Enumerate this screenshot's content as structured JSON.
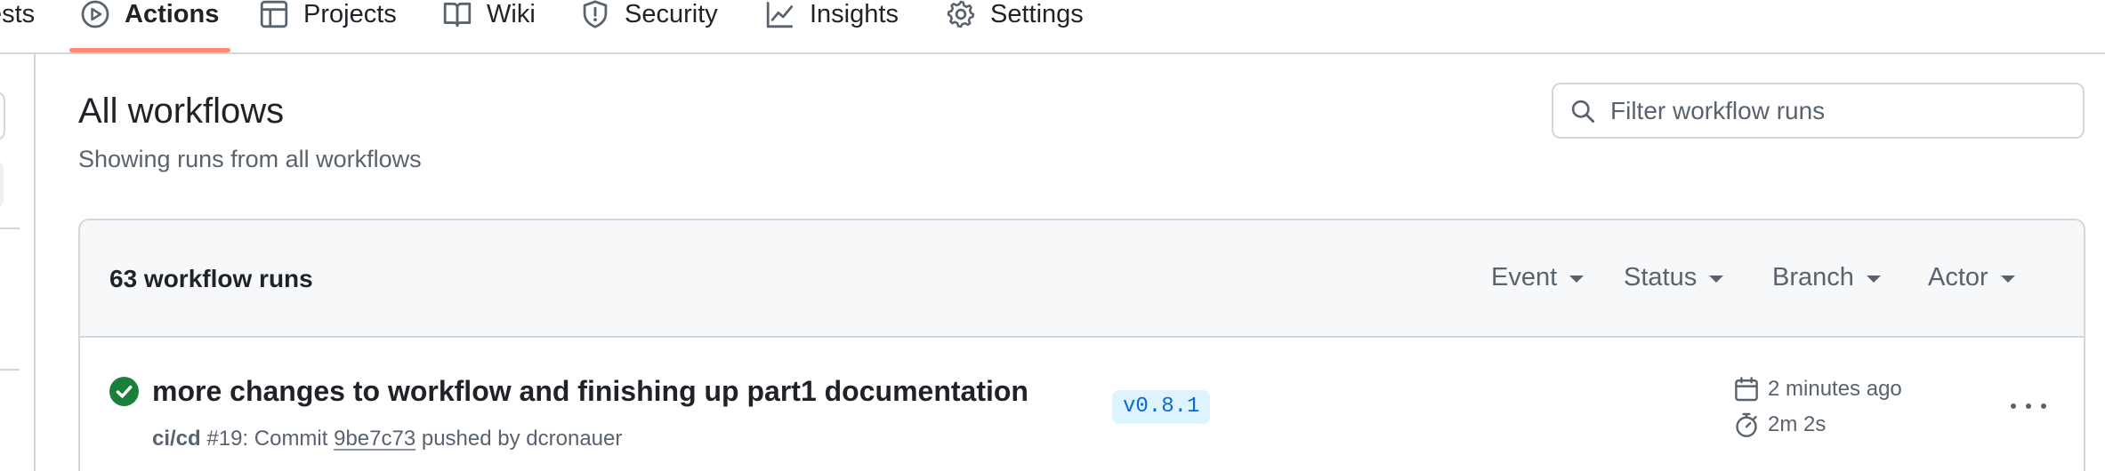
{
  "nav": {
    "tabs": [
      {
        "label": "ests",
        "icon": "pull-request-icon"
      },
      {
        "label": "Actions",
        "icon": "play-icon",
        "active": true
      },
      {
        "label": "Projects",
        "icon": "table-icon"
      },
      {
        "label": "Wiki",
        "icon": "book-icon"
      },
      {
        "label": "Security",
        "icon": "shield-icon"
      },
      {
        "label": "Insights",
        "icon": "graph-icon"
      },
      {
        "label": "Settings",
        "icon": "gear-icon"
      }
    ],
    "active_color": "#fd8c73"
  },
  "header": {
    "title": "All workflows",
    "subtitle": "Showing runs from all workflows",
    "filter_placeholder": "Filter workflow runs"
  },
  "runs": {
    "count_label": "63 workflow runs",
    "filters": [
      "Event",
      "Status",
      "Branch",
      "Actor"
    ],
    "items": [
      {
        "title": "more changes to workflow and finishing up part1 documentation",
        "workflow": "ci/cd",
        "run_number": "#19",
        "meta_middle": ": Commit ",
        "commit": "9be7c73",
        "meta_end": " pushed by dcronauer",
        "branch": "v0.8.1",
        "time_ago": "2 minutes ago",
        "duration": "2m 2s",
        "status": "success",
        "status_color": "#1a7f37"
      }
    ]
  }
}
